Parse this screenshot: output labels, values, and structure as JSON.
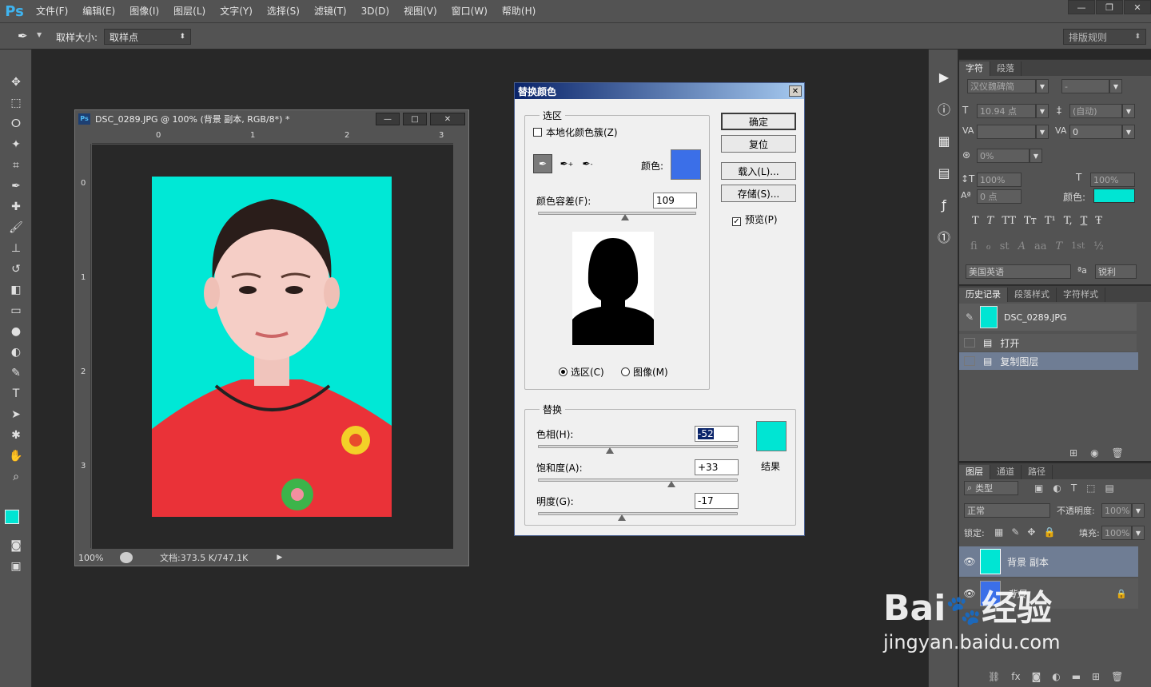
{
  "app": {
    "logo": "Ps"
  },
  "menu": [
    "文件(F)",
    "编辑(E)",
    "图像(I)",
    "图层(L)",
    "文字(Y)",
    "选择(S)",
    "滤镜(T)",
    "3D(D)",
    "视图(V)",
    "窗口(W)",
    "帮助(H)"
  ],
  "window_controls": {
    "minimize": "—",
    "restore": "❐",
    "close": "✕"
  },
  "options": {
    "sample_size_label": "取样大小:",
    "sample_size_value": "取样点",
    "workspace": "排版规则"
  },
  "document": {
    "title": "DSC_0289.JPG @ 100% (背景 副本, RGB/8*) *",
    "ruler_h": [
      "0",
      "1",
      "2",
      "3"
    ],
    "ruler_v": [
      "0",
      "1",
      "2",
      "3"
    ],
    "zoom": "100%",
    "doc_size": "文档:373.5 K/747.1K",
    "photo_bg": "#00E8D6"
  },
  "dialog": {
    "title": "替换颜色",
    "selection_group": "选区",
    "localized": "本地化颜色簇(Z)",
    "color_label": "颜色:",
    "selection_color": "#3B6FE8",
    "fuzziness_label": "颜色容差(F):",
    "fuzziness_value": "109",
    "fuzziness_level": 109,
    "radio_selection": "选区(C)",
    "radio_image": "图像(M)",
    "replace_group": "替换",
    "hue_label": "色相(H):",
    "hue_value": "-52",
    "hue_level": -52,
    "sat_label": "饱和度(A):",
    "sat_value": "+33",
    "sat_level": 33,
    "light_label": "明度(G):",
    "light_value": "-17",
    "light_level": -17,
    "result_label": "结果",
    "result_color": "#00E5D3",
    "ok": "确定",
    "reset": "复位",
    "load": "载入(L)...",
    "save": "存储(S)...",
    "preview": "预览(P)"
  },
  "character_panel": {
    "tabs": [
      "字符",
      "段落"
    ],
    "font_family": "汉仪魏碑简",
    "font_style": "-",
    "font_size": "10.94 点",
    "leading": "(自动)",
    "kerning": "",
    "tracking": "0",
    "vscale_pct": "0%",
    "scale_v": "100%",
    "scale_h": "100%",
    "baseline": "0 点",
    "color_label": "颜色:",
    "text_color": "#00E5D3",
    "style_buttons": [
      "T",
      "T",
      "TT",
      "Tт",
      "T¹",
      "T,",
      "T",
      "Ŧ"
    ],
    "opentype_buttons": [
      "fi",
      "ℴ",
      "st",
      "A",
      "aa",
      "T",
      "1st",
      "½"
    ],
    "language": "美国英语",
    "aa_icon": "ªa",
    "antialias": "锐利"
  },
  "history_panel": {
    "tabs": [
      "历史记录",
      "段落样式",
      "字符样式"
    ],
    "snapshot": "DSC_0289.JPG",
    "items": [
      "打开",
      "复制图层"
    ]
  },
  "layers_panel": {
    "tabs": [
      "图层",
      "通道",
      "路径"
    ],
    "filter": "类型",
    "blend_mode": "正常",
    "opacity_label": "不透明度:",
    "opacity": "100%",
    "lock_label": "锁定:",
    "fill_label": "填充:",
    "fill": "100%",
    "layers": [
      "背景 副本",
      "背景"
    ]
  },
  "watermark": {
    "brand": "Bai",
    "brand_cn": "经验",
    "url": "jingyan.baidu.com"
  }
}
